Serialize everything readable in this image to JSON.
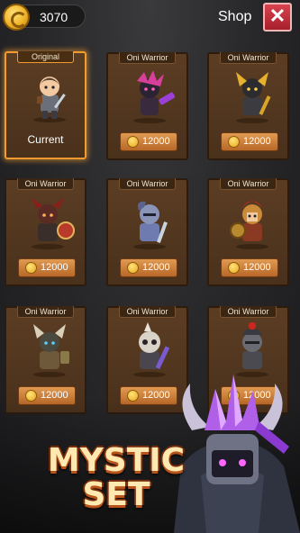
{
  "header": {
    "coins": "3070",
    "title": "Shop",
    "close_label": "✕"
  },
  "cards": [
    {
      "label": "Original",
      "status": "Current",
      "selected": true
    },
    {
      "label": "Oni Warrior",
      "price": "12000"
    },
    {
      "label": "Oni Warrior",
      "price": "12000"
    },
    {
      "label": "Oni Warrior",
      "price": "12000"
    },
    {
      "label": "Oni Warrior",
      "price": "12000"
    },
    {
      "label": "Oni Warrior",
      "price": "12000"
    },
    {
      "label": "Oni Warrior",
      "price": "12000"
    },
    {
      "label": "Oni Warrior",
      "price": "12000"
    },
    {
      "label": "Oni Warrior",
      "price": "12000"
    }
  ],
  "promo": {
    "line1": "MYSTIC",
    "line2": "SET"
  }
}
